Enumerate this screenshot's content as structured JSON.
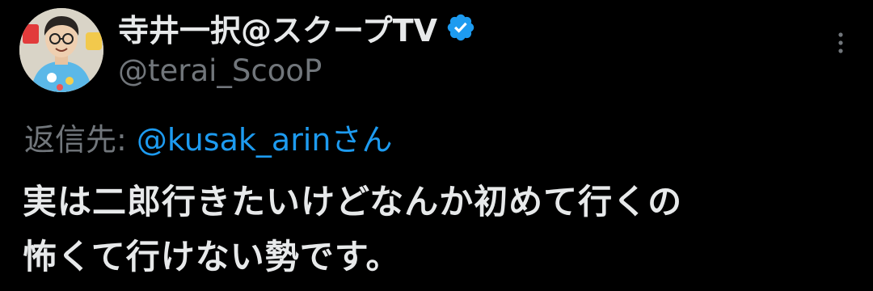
{
  "tweet": {
    "author": {
      "display_name": "寺井一択@スクープTV",
      "handle": "@terai_ScooP",
      "verified_icon": "verified-badge-icon",
      "avatar_icon": "avatar-image"
    },
    "more_icon": "more-options-icon",
    "reply": {
      "prefix": "返信先: ",
      "handle": "@kusak_arin",
      "suffix": "さん"
    },
    "text_lines": [
      "実は二郎行きたいけどなんか初めて行くの",
      "怖くて行けない勢です。"
    ]
  },
  "colors": {
    "background": "#000000",
    "primary_text": "#e7e9ea",
    "secondary_text": "#71767b",
    "link": "#1d9bf0",
    "verified": "#1d9bf0"
  }
}
